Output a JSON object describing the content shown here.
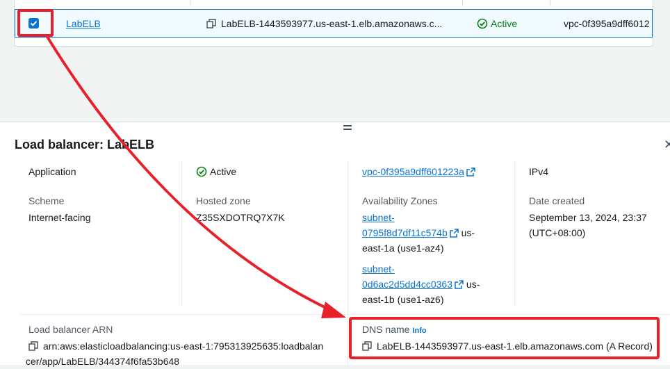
{
  "table": {
    "row": {
      "name": "LabELB",
      "dns": "LabELB-1443593977.us-east-1.elb.amazonaws.c...",
      "state": "Active",
      "vpc": "vpc-0f395a9dff6012"
    }
  },
  "panel": {
    "title": "Load balancer: LabELB",
    "type_value": "Application",
    "status_value": "Active",
    "vpc_value": "vpc-0f395a9dff601223a",
    "ip_value": "IPv4",
    "scheme_label": "Scheme",
    "scheme_value": "Internet-facing",
    "zone_label": "Hosted zone",
    "zone_value": "Z35SXDOTRQ7X7K",
    "az_label": "Availability Zones",
    "subnet1_line1": "subnet-",
    "subnet1_line2": "0795f8d7df11c574b",
    "subnet1_tail": "us-",
    "subnet1_zone": "east-1a (use1-az4)",
    "subnet2_line1": "subnet-",
    "subnet2_line2": "0d6ac2d5dd4cc0363",
    "subnet2_tail": "us-",
    "subnet2_zone": "east-1b (use1-az6)",
    "date_label": "Date created",
    "date_line1": "September 13, 2024, 23:37",
    "date_line2": "(UTC+08:00)",
    "arn_label": "Load balancer ARN",
    "arn_line1": "arn:aws:elasticloadbalancing:us-east-1:795313925635:loadbalan",
    "arn_line2": "cer/app/LabELB/344374f6fa53b648",
    "dns_label": "DNS name",
    "dns_info": "Info",
    "dns_value": "LabELB-1443593977.us-east-1.elb.amazonaws.com (A Record)"
  },
  "colors": {
    "accent": "#0972d3",
    "success": "#037f0c",
    "annotation": "#e8202a"
  },
  "icons": [
    "checkbox-checked-icon",
    "copy-icon",
    "status-success-icon",
    "external-link-icon",
    "close-icon",
    "drag-handle-icon"
  ]
}
